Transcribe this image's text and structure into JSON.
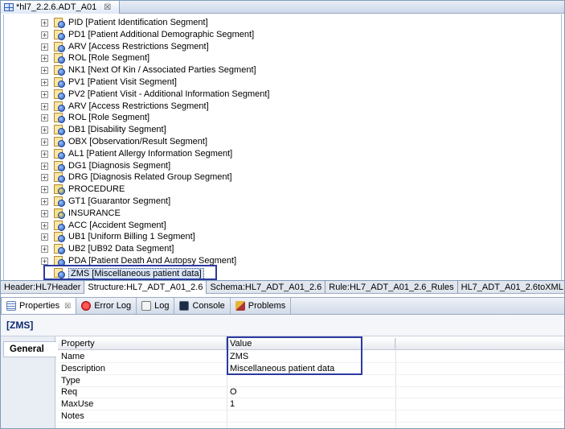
{
  "editor_tab": {
    "title": "*hl7_2.2.6.ADT_A01",
    "close": "☒"
  },
  "tree": {
    "items": [
      {
        "label": "PID [Patient Identification Segment]",
        "kind": "segment"
      },
      {
        "label": "PD1 [Patient Additional Demographic Segment]",
        "kind": "segment"
      },
      {
        "label": "ARV [Access Restrictions Segment]",
        "kind": "segment"
      },
      {
        "label": "ROL [Role Segment]",
        "kind": "segment"
      },
      {
        "label": "NK1 [Next Of Kin / Associated Parties Segment]",
        "kind": "segment"
      },
      {
        "label": "PV1 [Patient Visit Segment]",
        "kind": "segment"
      },
      {
        "label": "PV2 [Patient Visit - Additional Information Segment]",
        "kind": "segment"
      },
      {
        "label": "ARV [Access Restrictions Segment]",
        "kind": "segment"
      },
      {
        "label": "ROL [Role Segment]",
        "kind": "segment"
      },
      {
        "label": "DB1 [Disability Segment]",
        "kind": "segment"
      },
      {
        "label": "OBX [Observation/Result Segment]",
        "kind": "segment"
      },
      {
        "label": "AL1 [Patient Allergy Information Segment]",
        "kind": "segment"
      },
      {
        "label": "DG1 [Diagnosis Segment]",
        "kind": "segment"
      },
      {
        "label": "DRG [Diagnosis Related Group Segment]",
        "kind": "segment"
      },
      {
        "label": "PROCEDURE",
        "kind": "group"
      },
      {
        "label": "GT1 [Guarantor Segment]",
        "kind": "segment"
      },
      {
        "label": "INSURANCE",
        "kind": "group"
      },
      {
        "label": "ACC [Accident Segment]",
        "kind": "segment"
      },
      {
        "label": "UB1 [Uniform Billing 1 Segment]",
        "kind": "segment"
      },
      {
        "label": "UB2 [UB92 Data Segment]",
        "kind": "segment"
      },
      {
        "label": "PDA [Patient Death And Autopsy Segment]",
        "kind": "segment"
      },
      {
        "label": "ZMS [Miscellaneous patient data]",
        "kind": "segment",
        "selected": true
      }
    ],
    "expander_glyph": "+"
  },
  "editor_pages": [
    "Header:HL7Header",
    "Structure:HL7_ADT_A01_2.6",
    "Schema:HL7_ADT_A01_2.6",
    "Rule:HL7_ADT_A01_2.6_Rules",
    "HL7_ADT_A01_2.6toXML"
  ],
  "views": [
    {
      "label": "Properties",
      "icon": "properties-icon",
      "close": "☒"
    },
    {
      "label": "Error Log",
      "icon": "error-log-icon"
    },
    {
      "label": "Log",
      "icon": "log-icon"
    },
    {
      "label": "Console",
      "icon": "console-icon"
    },
    {
      "label": "Problems",
      "icon": "problems-icon"
    }
  ],
  "properties": {
    "title": "[ZMS]",
    "side_tab": "General",
    "columns": [
      "Property",
      "Value"
    ],
    "rows": [
      {
        "property": "Name",
        "value": "ZMS"
      },
      {
        "property": "Description",
        "value": "Miscellaneous patient data"
      },
      {
        "property": "Type",
        "value": ""
      },
      {
        "property": "Req",
        "value": "O"
      },
      {
        "property": "MaxUse",
        "value": "1"
      },
      {
        "property": "Notes",
        "value": ""
      }
    ]
  },
  "colors": {
    "highlight_box": "#2c3aa0",
    "selection": "#d8e4f7"
  }
}
